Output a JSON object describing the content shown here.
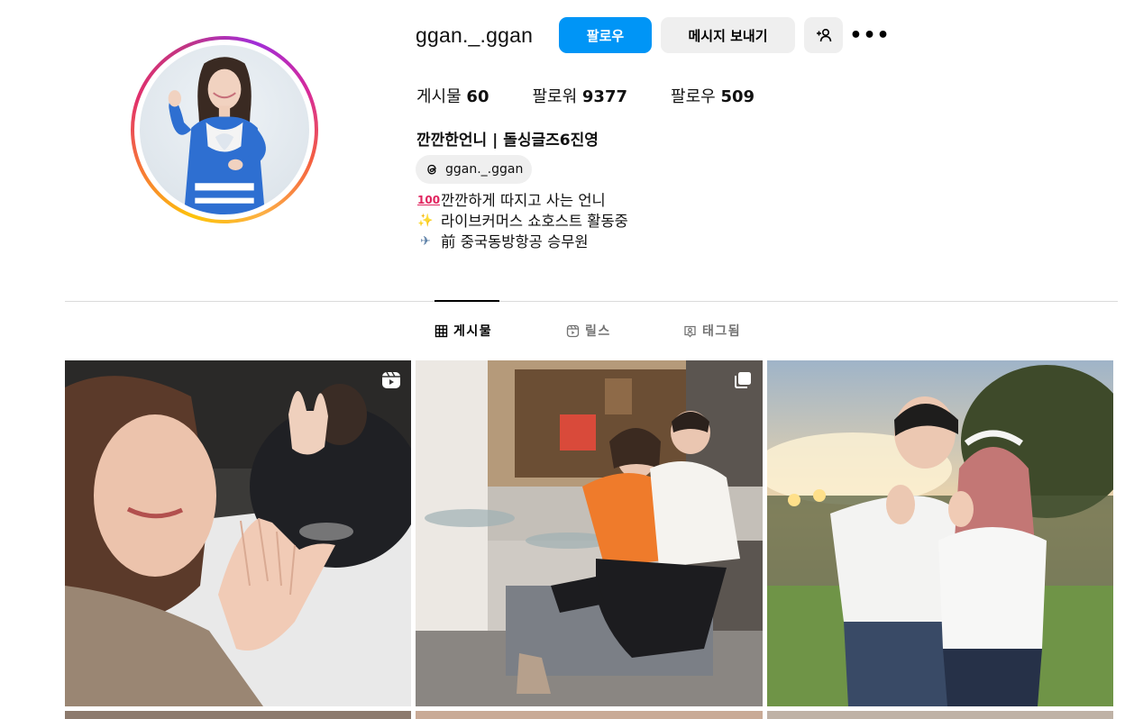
{
  "profile": {
    "username": "ggan._.ggan",
    "full_name": "깐깐한언니 | 돌싱글즈6진영",
    "threads_handle": "ggan._.ggan",
    "bio": [
      {
        "icon": "hundred-points-emoji",
        "glyph": "100",
        "text": "깐깐하게 따지고 사는 언니"
      },
      {
        "icon": "sparkles-emoji",
        "glyph": "✨",
        "text": "라이브커머스 쇼호스트 활동중"
      },
      {
        "icon": "airplane-emoji",
        "glyph": "✈",
        "text": "前 중국동방항공 승무원"
      }
    ]
  },
  "actions": {
    "follow_label": "팔로우",
    "message_label": "메시지 보내기",
    "suggest_icon": "person-plus-icon",
    "more_glyph": "•••"
  },
  "stats": {
    "posts_label": "게시물",
    "posts_value": "60",
    "followers_label": "팔로워",
    "followers_value": "9377",
    "following_label": "팔로우",
    "following_value": "509"
  },
  "tabs": [
    {
      "label": "게시물",
      "icon": "grid-icon",
      "active": true
    },
    {
      "label": "릴스",
      "icon": "reels-icon",
      "active": false
    },
    {
      "label": "태그됨",
      "icon": "tagged-icon",
      "active": false
    }
  ],
  "posts": [
    {
      "type": "reel",
      "badge_icon": "reels-icon"
    },
    {
      "type": "carousel",
      "badge_icon": "carousel-icon"
    },
    {
      "type": "photo"
    }
  ],
  "colors": {
    "accent": "#0095f6",
    "button_secondary": "#efefef",
    "divider": "#dbdbdb"
  }
}
